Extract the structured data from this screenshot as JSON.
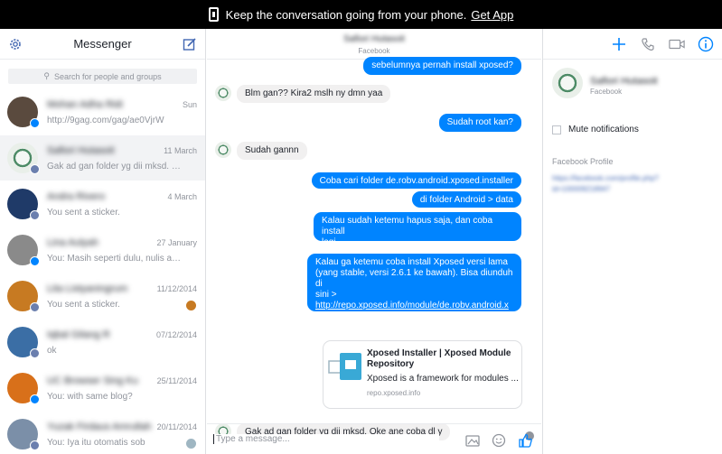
{
  "banner": {
    "text": "Keep the conversation going from your phone.",
    "link": "Get App"
  },
  "sidebar": {
    "title": "Messenger",
    "search_placeholder": "Search for people and groups",
    "conversations": [
      {
        "name": "Mohan Adha Ridi",
        "snippet": "http://9gag.com/gag/ae0VjrW",
        "date": "Sun",
        "avatar_color": "#5a4a3e",
        "badge": "m"
      },
      {
        "name": "Safiori Hutasoit",
        "snippet": "Gak ad gan folder yg dii mksd. Oke ...",
        "date": "11 March",
        "avatar_color": "#4d8b66",
        "badge": "f"
      },
      {
        "name": "Andra Rivero",
        "snippet": "You sent a sticker.",
        "date": "4 March",
        "avatar_color": "#1f3a68",
        "badge": "f"
      },
      {
        "name": "Lina Aulyah",
        "snippet": "You: Masih seperti dulu, nulis artikel...",
        "date": "27 January",
        "avatar_color": "#8a8a8a",
        "badge": "m"
      },
      {
        "name": "Lita Listyaningrum",
        "snippet": "You sent a sticker.",
        "date": "11/12/2014",
        "avatar_color": "#c77a22",
        "badge": "f"
      },
      {
        "name": "Iqbal Gilang R",
        "snippet": "ok",
        "date": "07/12/2014",
        "avatar_color": "#3b6ea5",
        "badge": "f"
      },
      {
        "name": "UC Browser Sing Ku",
        "snippet": "You: with same blog?",
        "date": "25/11/2014",
        "avatar_color": "#d8701a",
        "badge": "m"
      },
      {
        "name": "Yuzak Firdaus Amrullah",
        "snippet": "You: Iya itu otomatis sob",
        "date": "20/11/2014",
        "avatar_color": "#7b8fa8",
        "badge": "f"
      }
    ]
  },
  "conversation": {
    "header_name": "Safiori Hutasoit",
    "header_sub": "Facebook",
    "messages": {
      "m0": "sebelumnya pernah install xposed?",
      "m1": "Blm gan?? Kira2 mslh ny dmn yaa",
      "m2": "Sudah root kan?",
      "m3": "Sudah gannn",
      "m4": "Coba cari folder de.robv.android.xposed.installer",
      "m5": "di folder Android > data",
      "m6a": "Kalau sudah ketemu hapus saja, dan coba install",
      "m6b": "lagi.",
      "m7a": "Kalau ga ketemu coba install Xposed versi lama",
      "m7b": "(yang stable, versi 2.6.1 ke bawah). Bisa diunduh di",
      "m7c": "sini >",
      "m7d": "http://repo.xposed.info/module/de.robv.android.x",
      "m7e": "posed.installer",
      "m8": "Gak ad gan folder yg dii mksd. Oke ane coba dl y"
    },
    "card": {
      "title": "Xposed Installer | Xposed Module Repository",
      "desc": "Xposed is a framework for modules ...",
      "domain": "repo.xposed.info"
    },
    "composer_placeholder": "Type a message..."
  },
  "info": {
    "name": "Safiori Hutasoit",
    "sub": "Facebook",
    "mute_label": "Mute notifications",
    "profile_label": "Facebook Profile",
    "profile_url": "https://facebook.com/profile.php?id=100009218947"
  },
  "colors": {
    "accent": "#0084ff",
    "bubble_in": "#f1f0f0",
    "banner": "#000000"
  }
}
